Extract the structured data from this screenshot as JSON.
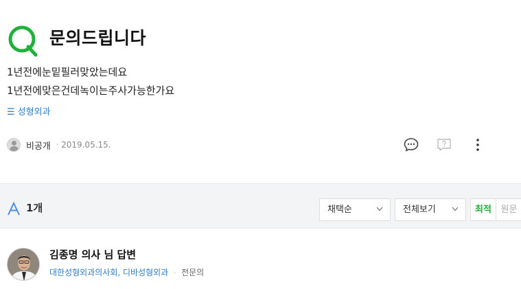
{
  "question": {
    "title": "문의드립니다",
    "body_lines": [
      "1년전에눈밑필러맞았는데요",
      "1년전에맞은건데녹이는주사가능한가요"
    ],
    "category_icon": "list-icon",
    "category_glyph": "☰",
    "category": "성형외과",
    "author": "비공개",
    "date": "2019.05.15."
  },
  "answers_bar": {
    "count": "1개",
    "sort_selected": "채택순",
    "view_selected": "전체보기",
    "toggle_latest": "최적",
    "toggle_original": "원문"
  },
  "answer": {
    "name": "김종명 의사 님 답변",
    "hospital": "대한성형외과의사회, 디바성형외과",
    "role": "전문의"
  },
  "colors": {
    "brand_green": "#1fb13a",
    "link_blue": "#2e7cc6",
    "answer_a_blue": "#4a8ce0",
    "bar_bg": "#f3f4f6"
  }
}
